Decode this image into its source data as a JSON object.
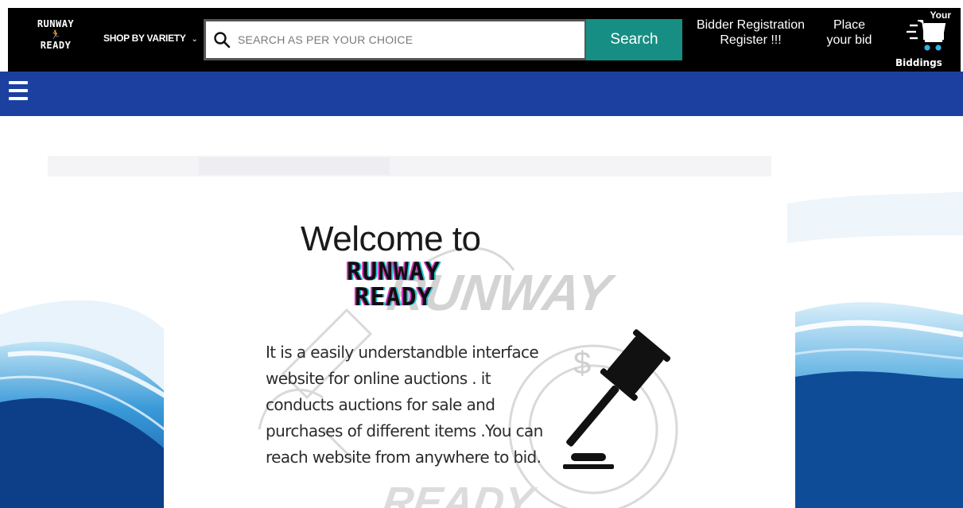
{
  "header": {
    "logo": {
      "line1": "RUNWAY",
      "line2": "READY"
    },
    "shop_menu": {
      "label": "SHOP BY VARIETY",
      "icon": "chevron-down-icon"
    },
    "search": {
      "placeholder": "SEARCH AS PER YOUR CHOICE",
      "value": "",
      "icon": "search-icon",
      "button_label": "Search"
    },
    "registration": {
      "line1": "Bidder Registration",
      "line2": "Register !!!"
    },
    "place_bid": {
      "line1": "Place",
      "line2": "your bid"
    },
    "cart": {
      "top_label": "Your",
      "bottom_label": "Biddings",
      "icon": "cart-icon"
    }
  },
  "nav": {
    "menu_icon": "hamburger-menu-icon"
  },
  "hero": {
    "welcome": "Welcome to",
    "brand_line1": "RUNWAY",
    "brand_line2": "READY",
    "description": "It is a easily understandble interface website for online auctions . it conducts auctions for sale and purchases of different items .You can reach website from anywhere to bid.",
    "watermark_line1": "RUNWAY",
    "watermark_line2": "READY",
    "gavel_icon": "gavel-icon"
  },
  "colors": {
    "header_bg": "#000000",
    "nav_bg": "#1b40a0",
    "search_button": "#178e83",
    "brand_accent_pink": "#d633b8",
    "brand_accent_cyan": "#25c5d6"
  }
}
